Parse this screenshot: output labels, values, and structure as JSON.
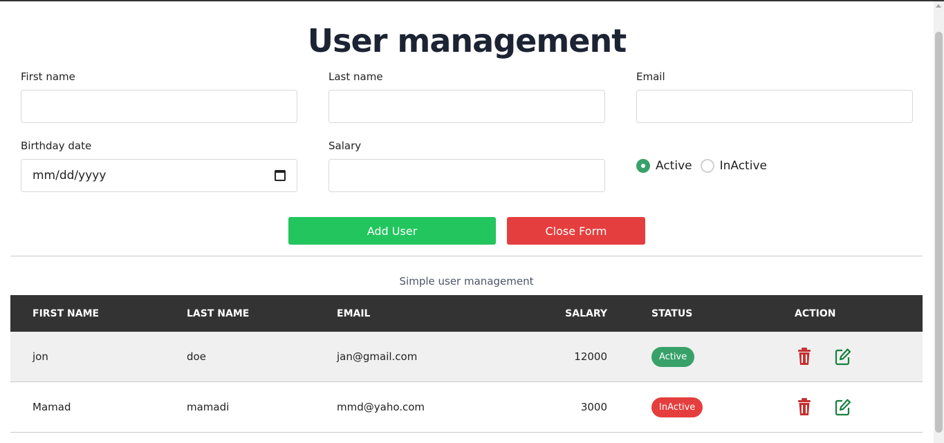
{
  "title": "User management",
  "form": {
    "first_name_label": "First name",
    "last_name_label": "Last name",
    "email_label": "Email",
    "birthday_label": "Birthday date",
    "birthday_placeholder": "mm/dd/yyyy",
    "salary_label": "Salary",
    "status_options": [
      "Active",
      "InActive"
    ],
    "selected_status": "Active",
    "add_button": "Add User",
    "close_button": "Close Form"
  },
  "table": {
    "caption": "Simple user management",
    "headers": [
      "FIRST NAME",
      "LAST NAME",
      "EMAIL",
      "SALARY",
      "STATUS",
      "ACTION"
    ],
    "rows": [
      {
        "first_name": "jon",
        "last_name": "doe",
        "email": "jan@gmail.com",
        "salary": "12000",
        "status": "Active"
      },
      {
        "first_name": "Mamad",
        "last_name": "mamadi",
        "email": "mmd@yaho.com",
        "salary": "3000",
        "status": "InActive"
      }
    ]
  },
  "colors": {
    "active": "#38a169",
    "inactive": "#e53e3e",
    "add_button": "#22c55e",
    "header_bg": "#333333",
    "delete_icon": "#c53030",
    "edit_icon": "#15803d"
  },
  "icons": {
    "delete": "trash-icon",
    "edit": "edit-icon"
  }
}
